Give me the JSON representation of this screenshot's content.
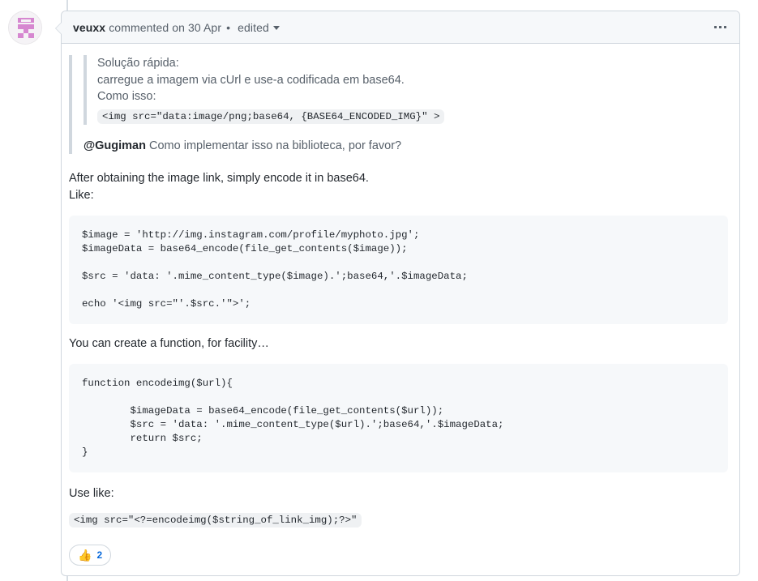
{
  "timeline": {
    "rail_color": "#d8dee4"
  },
  "avatar": {
    "name": "veuxx-avatar",
    "identicon_color": "#d687d0",
    "background": "#f5f3f6"
  },
  "header": {
    "author": "veuxx",
    "action": "commented on 30 Apr",
    "separator": "•",
    "edited_label": "edited",
    "caret_icon": "chevron-down-icon",
    "menu_icon": "kebab-horizontal-icon"
  },
  "body": {
    "quote": {
      "lines": [
        "Solução rápida:",
        "carregue a imagem via cUrl e use-a codificada em base64.",
        "Como isso:"
      ],
      "inline_code": "<img src=\"data:image/png;base64, {BASE64_ENCODED_IMG}\" >",
      "mention": "@Gugiman",
      "mention_text": " Como implementar isso na biblioteca, por favor?"
    },
    "paragraph_1_line_1": "After obtaining the image link, simply encode it in base64.",
    "paragraph_1_line_2": "Like:",
    "code_block_1": "$image = 'http://img.instagram.com/profile/myphoto.jpg';\n$imageData = base64_encode(file_get_contents($image));\n\n$src = 'data: '.mime_content_type($image).';base64,'.$imageData;\n\necho '<img src=\"'.$src.'\">';",
    "paragraph_2": "You can create a function, for facility…",
    "code_block_2": "function encodeimg($url){\n\n        $imageData = base64_encode(file_get_contents($url));\n        $src = 'data: '.mime_content_type($url).';base64,'.$imageData;\n        return $src;\n}",
    "paragraph_3": "Use like:",
    "inline_code_2": "<img src=\"<?=encodeimg($string_of_link_img);?>\""
  },
  "reactions": [
    {
      "icon": "thumbs-up-icon",
      "emoji": "👍",
      "count": "2",
      "count_color": "#0969da"
    }
  ],
  "colors": {
    "header_bg": "#f6f8fa",
    "border": "#d0d7de",
    "code_bg": "#f6f8fa",
    "text": "#24292f",
    "muted_text": "#57606a",
    "link": "#0969da"
  }
}
